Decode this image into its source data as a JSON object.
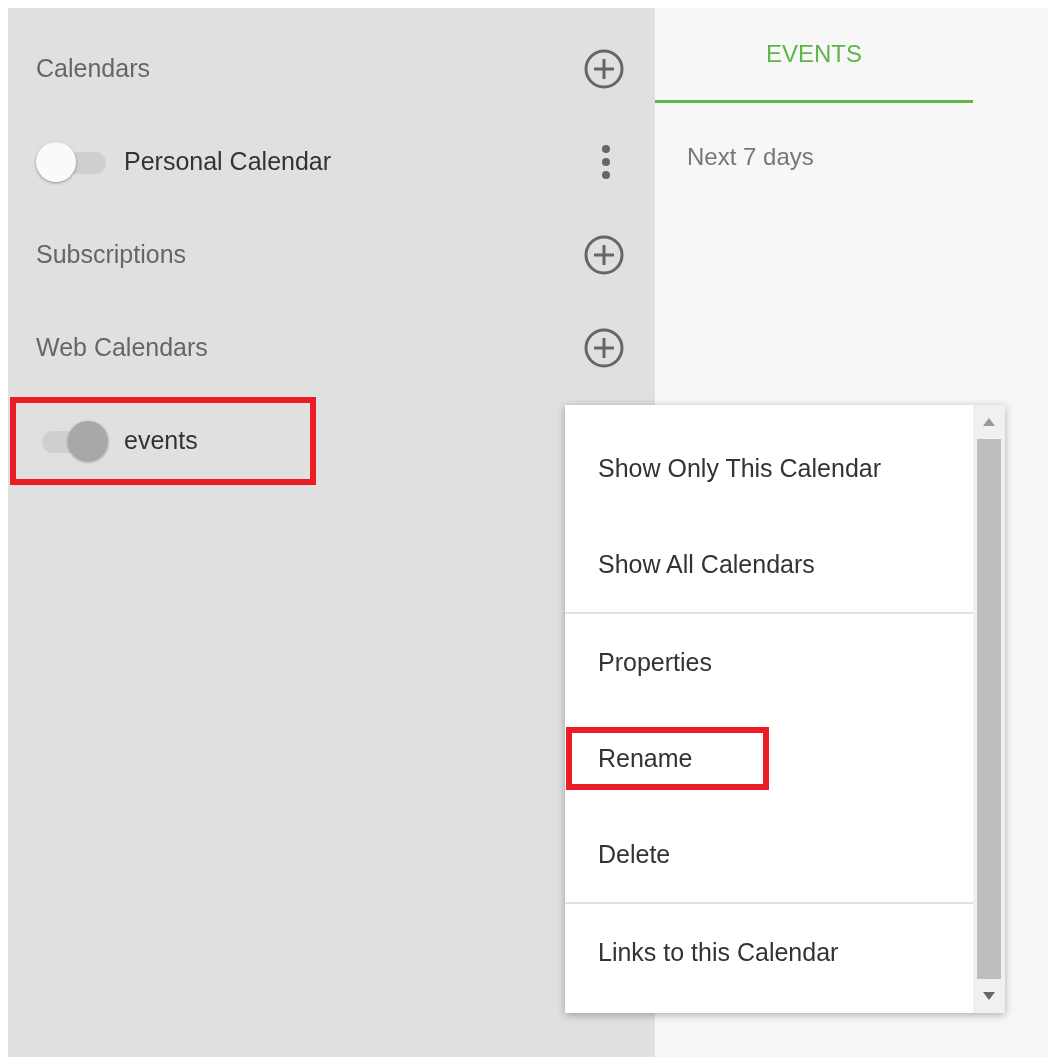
{
  "sidebar": {
    "sections": [
      {
        "title": "Calendars",
        "items": [
          {
            "name": "Personal Calendar",
            "on": false,
            "highlighted": false,
            "menu_button": true
          }
        ]
      },
      {
        "title": "Subscriptions"
      },
      {
        "title": "Web Calendars",
        "items": [
          {
            "name": "events",
            "on": true,
            "highlighted": true,
            "menu_button": false
          }
        ]
      }
    ]
  },
  "tabs": [
    {
      "label": "EVENTS",
      "selected": true
    }
  ],
  "events_panel": {
    "range": "Next 7 days"
  },
  "context_menu": {
    "groups": [
      {
        "items": [
          {
            "label": "Show Only This Calendar",
            "highlighted": false
          },
          {
            "label": "Show All Calendars",
            "highlighted": false
          }
        ]
      },
      {
        "items": [
          {
            "label": "Properties",
            "highlighted": false
          },
          {
            "label": "Rename",
            "highlighted": true
          },
          {
            "label": "Delete",
            "highlighted": false
          }
        ]
      },
      {
        "items": [
          {
            "label": "Links to this Calendar",
            "highlighted": false
          }
        ]
      }
    ]
  }
}
